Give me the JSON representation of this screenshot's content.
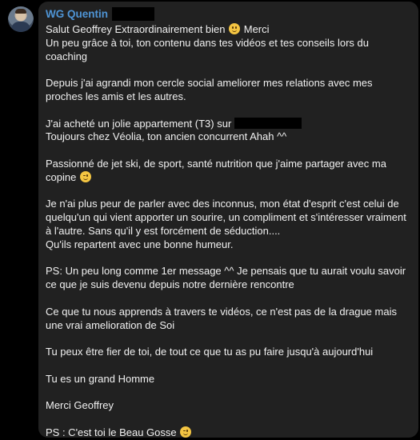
{
  "sender": {
    "name": "WG Quentin"
  },
  "message": {
    "line1_before": "Salut Geoffrey Extraordinairement bien",
    "line1_after": "Merci",
    "line2": "Un peu grâce à toi, ton contenu dans tes vidéos et tes conseils lors du coaching",
    "para2": "Depuis j'ai agrandi mon cercle social ameliorer mes relations avec mes proches les amis et les autres.",
    "para3_line1": "J'ai acheté un jolie appartement (T3) sur",
    "para3_line2": "Toujours chez Véolia, ton ancien concurrent Ahah ^^",
    "para4": "Passionné de jet ski, de sport, santé nutrition que j'aime partager avec ma copine",
    "para5_line1": "Je n'ai plus peur de parler avec des inconnus, mon état d'esprit c'est celui de quelqu'un qui vient apporter un sourire, un compliment et s'intéresser vraiment à l'autre. Sans qu'il y est forcément de séduction....",
    "para5_line2": "Qu'ils repartent avec une bonne humeur.",
    "para6": "PS: Un peu long comme 1er message ^^ Je pensais que tu aurait voulu savoir ce que je suis devenu depuis notre dernière rencontre",
    "para7": "Ce que tu nous apprends à travers te vidéos, ce n'est pas de la drague mais une vrai amelioration de Soi",
    "para8": "Tu peux être fier de toi, de tout ce que tu as pu faire jusqu'à aujourd'hui",
    "para9": "Tu es un grand Homme",
    "para10": "Merci Geoffrey",
    "para11": "PS : C'est toi le Beau Gosse"
  },
  "icons": {
    "smile": "slightly-smiling-face-emoji",
    "wink": "winking-face-emoji"
  },
  "colors": {
    "background": "#000000",
    "bubble": "#212121",
    "sender": "#4f95d6",
    "text": "#f1f1f1"
  }
}
